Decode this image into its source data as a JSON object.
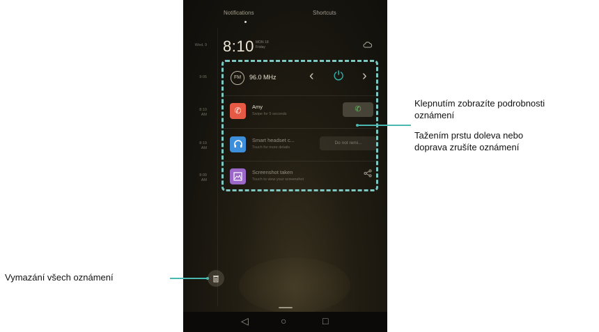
{
  "phone": {
    "tabs": {
      "notifications": "Notifications",
      "shortcuts": "Shortcuts"
    },
    "lockscreen": {
      "time": "8:10",
      "date_line1": "MON 18",
      "date_line2": "Friday"
    },
    "side_times": [
      "Wed, 9",
      "9:05",
      "8:10\nAM",
      "8:19\nAM",
      "8:09\nAM"
    ],
    "fm": {
      "badge": "FM",
      "frequency": "96.0 MHz"
    },
    "notifications": [
      {
        "title": "Amy",
        "subtitle": "Swipe for 5 seconds",
        "icon": "phone-hangup-icon",
        "color": "#e65a45"
      },
      {
        "title": "Smart headset c...",
        "subtitle": "Touch for more details",
        "icon": "headset-icon",
        "color": "#3d8fdc",
        "action": "Do not remi..."
      },
      {
        "title": "Screenshot taken",
        "subtitle": "Touch to view your screenshot",
        "icon": "image-icon",
        "color": "#9b67c9"
      }
    ]
  },
  "callouts": {
    "tap_line1": "Klepnutím zobrazíte podrobnosti",
    "tap_line2": "oznámení",
    "swipe_line1": "Tažením prstu doleva nebo",
    "swipe_line2": "doprava zrušíte oznámení",
    "clear_all": "Vymazání všech oznámení"
  },
  "colors": {
    "accent": "#49b8b0",
    "dashed_box": "#7dc8c2",
    "power_icon": "#2fb7b0",
    "call_green": "#67c167"
  }
}
